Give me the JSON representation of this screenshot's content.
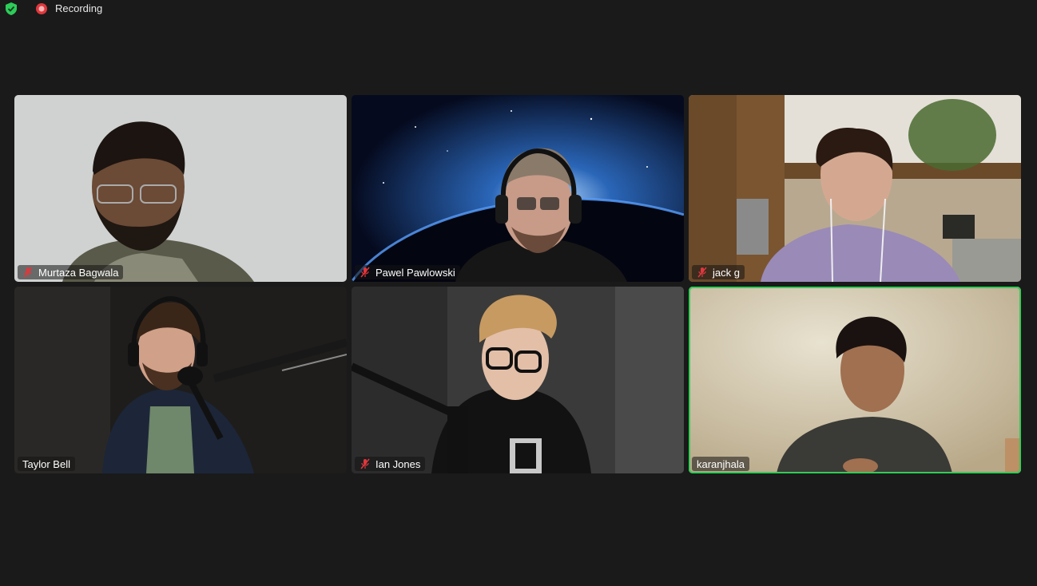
{
  "topbar": {
    "recording_label": "Recording",
    "icons": [
      "shield-check-icon",
      "recording-icon"
    ]
  },
  "colors": {
    "background": "#1a1a1a",
    "active_speaker_border": "#33cc55",
    "mute_icon": "#e0373c",
    "secure_green": "#2ecc5a"
  },
  "participants": [
    {
      "name": "Murtaza Bagwala",
      "muted": true,
      "active": false
    },
    {
      "name": "Pawel Pawlowski",
      "muted": true,
      "active": false
    },
    {
      "name": "jack g",
      "muted": true,
      "active": false
    },
    {
      "name": "Taylor Bell",
      "muted": false,
      "active": false
    },
    {
      "name": "Ian Jones",
      "muted": true,
      "active": false
    },
    {
      "name": "karanjhala",
      "muted": false,
      "active": true
    }
  ]
}
